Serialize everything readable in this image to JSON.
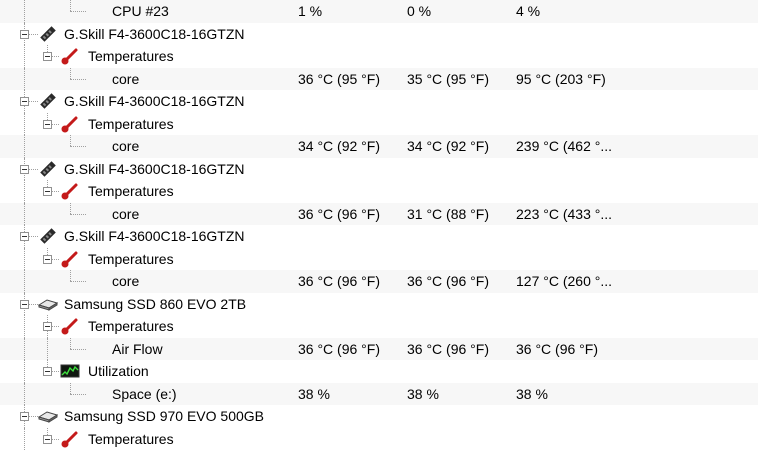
{
  "rows": [
    {
      "id": "cpu23",
      "type": "leaf",
      "label": "CPU #23",
      "v1": "1 %",
      "v2": "0 %",
      "v3": "4 %"
    },
    {
      "id": "dimm1",
      "type": "device",
      "icon": "memory-stick-icon",
      "label": "G.Skill F4-3600C18-16GTZN"
    },
    {
      "id": "dimm1-temps",
      "type": "group",
      "icon": "thermometer-icon",
      "label": "Temperatures"
    },
    {
      "id": "dimm1-core",
      "type": "leaf",
      "label": "core",
      "v1": "36 °C  (95 °F)",
      "v2": "35 °C  (95 °F)",
      "v3": "95 °C  (203 °F)"
    },
    {
      "id": "dimm2",
      "type": "device",
      "icon": "memory-stick-icon",
      "label": "G.Skill F4-3600C18-16GTZN"
    },
    {
      "id": "dimm2-temps",
      "type": "group",
      "icon": "thermometer-icon",
      "label": "Temperatures"
    },
    {
      "id": "dimm2-core",
      "type": "leaf",
      "label": "core",
      "v1": "34 °C  (92 °F)",
      "v2": "34 °C  (92 °F)",
      "v3": "239 °C  (462 °..."
    },
    {
      "id": "dimm3",
      "type": "device",
      "icon": "memory-stick-icon",
      "label": "G.Skill F4-3600C18-16GTZN"
    },
    {
      "id": "dimm3-temps",
      "type": "group",
      "icon": "thermometer-icon",
      "label": "Temperatures"
    },
    {
      "id": "dimm3-core",
      "type": "leaf",
      "label": "core",
      "v1": "36 °C  (96 °F)",
      "v2": "31 °C  (88 °F)",
      "v3": "223 °C  (433 °..."
    },
    {
      "id": "dimm4",
      "type": "device",
      "icon": "memory-stick-icon",
      "label": "G.Skill F4-3600C18-16GTZN"
    },
    {
      "id": "dimm4-temps",
      "type": "group",
      "icon": "thermometer-icon",
      "label": "Temperatures"
    },
    {
      "id": "dimm4-core",
      "type": "leaf",
      "label": "core",
      "v1": "36 °C  (96 °F)",
      "v2": "36 °C  (96 °F)",
      "v3": "127 °C  (260 °..."
    },
    {
      "id": "ssd1",
      "type": "device",
      "icon": "hard-drive-icon",
      "label": "Samsung SSD 860 EVO 2TB"
    },
    {
      "id": "ssd1-temps",
      "type": "group",
      "icon": "thermometer-icon",
      "label": "Temperatures"
    },
    {
      "id": "ssd1-airflow",
      "type": "leaf",
      "label": "Air Flow",
      "v1": "36 °C  (96 °F)",
      "v2": "36 °C  (96 °F)",
      "v3": "36 °C  (96 °F)"
    },
    {
      "id": "ssd1-util",
      "type": "group",
      "icon": "utilization-graph-icon",
      "label": "Utilization"
    },
    {
      "id": "ssd1-space",
      "type": "leaf",
      "label": "Space (e:)",
      "v1": "38 %",
      "v2": "38 %",
      "v3": "38 %"
    },
    {
      "id": "ssd2",
      "type": "device",
      "icon": "hard-drive-icon",
      "label": "Samsung SSD 970 EVO 500GB"
    },
    {
      "id": "ssd2-temps",
      "type": "group",
      "icon": "thermometer-icon",
      "label": "Temperatures"
    }
  ]
}
